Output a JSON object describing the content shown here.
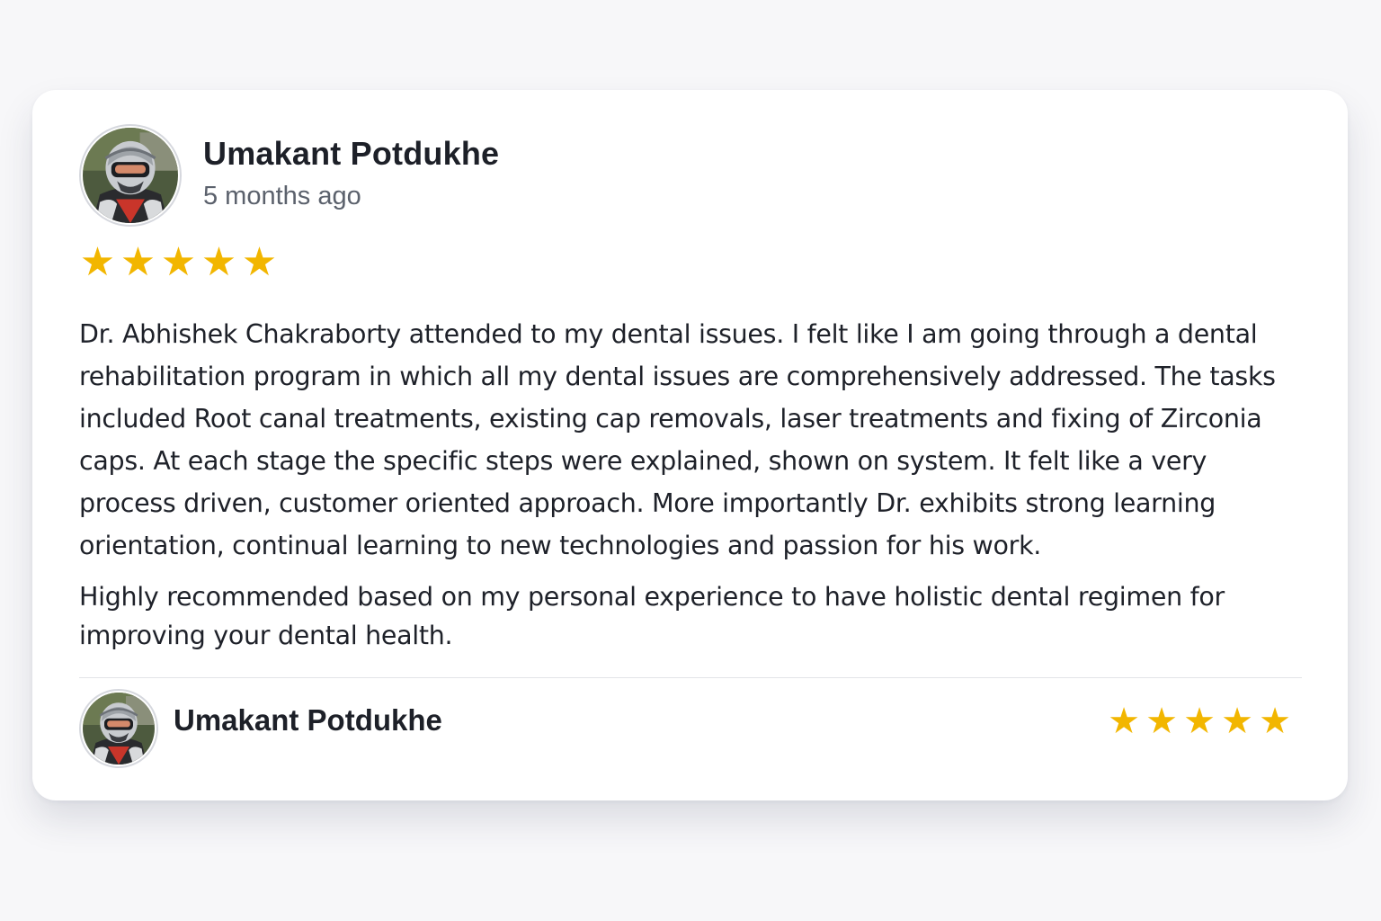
{
  "review": {
    "reviewer_name": "Umakant Potdukhe",
    "time_ago": "5 months ago",
    "rating": 5,
    "star_glyph": "★",
    "body_paragraphs": [
      "Dr. Abhishek Chakraborty attended to my dental issues. I felt like I am going through a dental rehabilitation program in which all my dental issues are comprehensively addressed. The tasks included Root canal treatments, existing cap removals, laser treatments and fixing of Zirconia caps. At each stage the specific steps were explained, shown on system. It felt like a very process driven, customer oriented approach. More importantly Dr. exhibits strong learning orientation, continual learning to new technologies and passion for his work.",
      "Highly recommended based on my personal experience to have holistic dental regimen for improving your dental health."
    ]
  },
  "footer": {
    "reviewer_name": "Umakant Potdukhe",
    "rating": 5
  },
  "colors": {
    "star": "#f2b600",
    "text": "#1e2129",
    "muted": "#5b616c",
    "card": "#ffffff",
    "background": "#f7f7f9"
  },
  "icons": {
    "avatar": "avatar-helmet-photo",
    "star": "star-icon"
  }
}
